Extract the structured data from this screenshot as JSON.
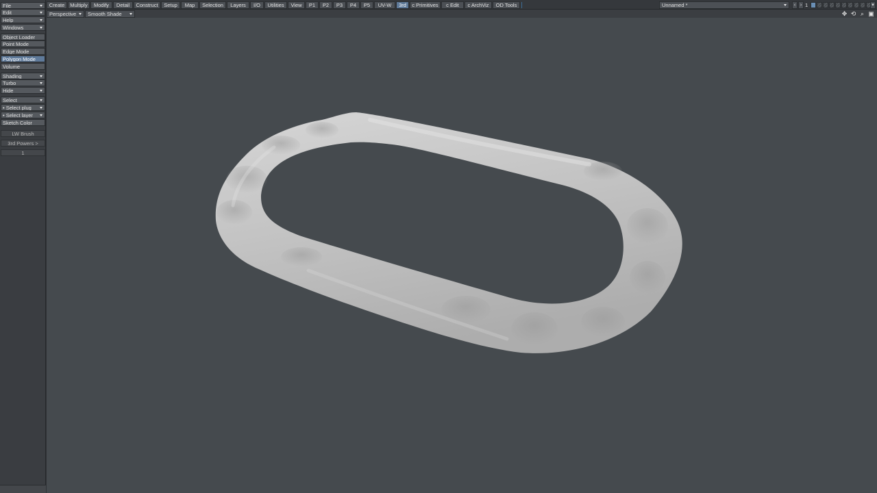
{
  "sidebar": {
    "menus": [
      {
        "label": "File"
      },
      {
        "label": "Edit"
      },
      {
        "label": "Help"
      },
      {
        "label": "Windows"
      }
    ],
    "modes": [
      {
        "label": "Object Loader"
      },
      {
        "label": "Point Mode"
      },
      {
        "label": "Edge Mode"
      },
      {
        "label": "Polygon Mode"
      },
      {
        "label": "Volume"
      }
    ],
    "display": [
      {
        "label": "Shading"
      },
      {
        "label": "Turbo"
      },
      {
        "label": "Hide"
      }
    ],
    "selection": [
      {
        "label": "Select"
      },
      {
        "label": "• Select plug"
      },
      {
        "label": "• Select layer"
      },
      {
        "label": "Sketch Color"
      }
    ],
    "extras": [
      {
        "label": "LW Brush"
      },
      {
        "label": "3rd Powers >"
      },
      {
        "label": "1"
      }
    ]
  },
  "tabs": [
    {
      "label": "Create"
    },
    {
      "label": "Multiply"
    },
    {
      "label": "Modify"
    },
    {
      "label": "Detail"
    },
    {
      "label": "Construct"
    },
    {
      "label": "Setup"
    },
    {
      "label": "Map"
    },
    {
      "label": "Selection"
    },
    {
      "label": "Layers"
    },
    {
      "label": "I/O"
    },
    {
      "label": "Utilities"
    },
    {
      "label": "View"
    },
    {
      "label": "P1"
    },
    {
      "label": "P2"
    },
    {
      "label": "P3"
    },
    {
      "label": "P4"
    },
    {
      "label": "P5"
    },
    {
      "label": "UV-W"
    },
    {
      "label": "3rd"
    },
    {
      "label": "c Primitives"
    },
    {
      "label": "c Edit"
    },
    {
      "label": "c ArchViz"
    },
    {
      "label": "OD Tools"
    }
  ],
  "active_tab": "3rd",
  "active_mode": "Polygon Mode",
  "object_name": "Unnamed *",
  "layer_number": "1",
  "viewport": {
    "view_type": "Perspective",
    "shading_mode": "Smooth Shade",
    "icons": [
      "move-view-icon",
      "rotate-view-icon",
      "zoom-view-icon",
      "maximize-view-icon"
    ]
  },
  "colors": {
    "accent": "#5d7897",
    "viewport_bg": "#454a4e",
    "model": "#c9c9c9"
  }
}
